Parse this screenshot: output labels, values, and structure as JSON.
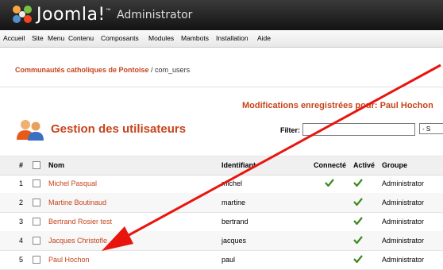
{
  "header": {
    "brand": "Joomla!",
    "trademark": "™",
    "subtitle": "Administrator"
  },
  "menu": [
    "Accueil",
    "Site",
    "Menu",
    "Contenu",
    "Composants",
    "Modules",
    "Mambots",
    "Installation",
    "Aide"
  ],
  "breadcrumb": {
    "site": "Communautés catholiques de Pontoise",
    "separator": " / ",
    "component": "com_users"
  },
  "message": "Modifications enregistrées pour: Paul Hochon",
  "page_title": "Gestion des utilisateurs",
  "filter": {
    "label": "Filter:",
    "value": "",
    "select": "- S"
  },
  "table": {
    "headers": {
      "num": "#",
      "name": "Nom",
      "login": "Identifiant",
      "connected": "Connecté",
      "active": "Activé",
      "group": "Groupe"
    },
    "rows": [
      {
        "num": "1",
        "name": "Michel Pasqual",
        "login": "michel",
        "connected": true,
        "active": true,
        "group": "Administrator"
      },
      {
        "num": "2",
        "name": "Martine Boutinaud",
        "login": "martine",
        "connected": false,
        "active": true,
        "group": "Administrator"
      },
      {
        "num": "3",
        "name": "Bertrand Rosier test",
        "login": "bertrand",
        "connected": false,
        "active": true,
        "group": "Administrator"
      },
      {
        "num": "4",
        "name": "Jacques Christofle",
        "login": "jacques",
        "connected": false,
        "active": true,
        "group": "Administrator"
      },
      {
        "num": "5",
        "name": "Paul Hochon",
        "login": "paul",
        "connected": false,
        "active": true,
        "group": "Administrator"
      }
    ]
  },
  "colors": {
    "accent": "#c6441b",
    "tick": "#3a8a1c",
    "arrow": "#e8150f"
  }
}
